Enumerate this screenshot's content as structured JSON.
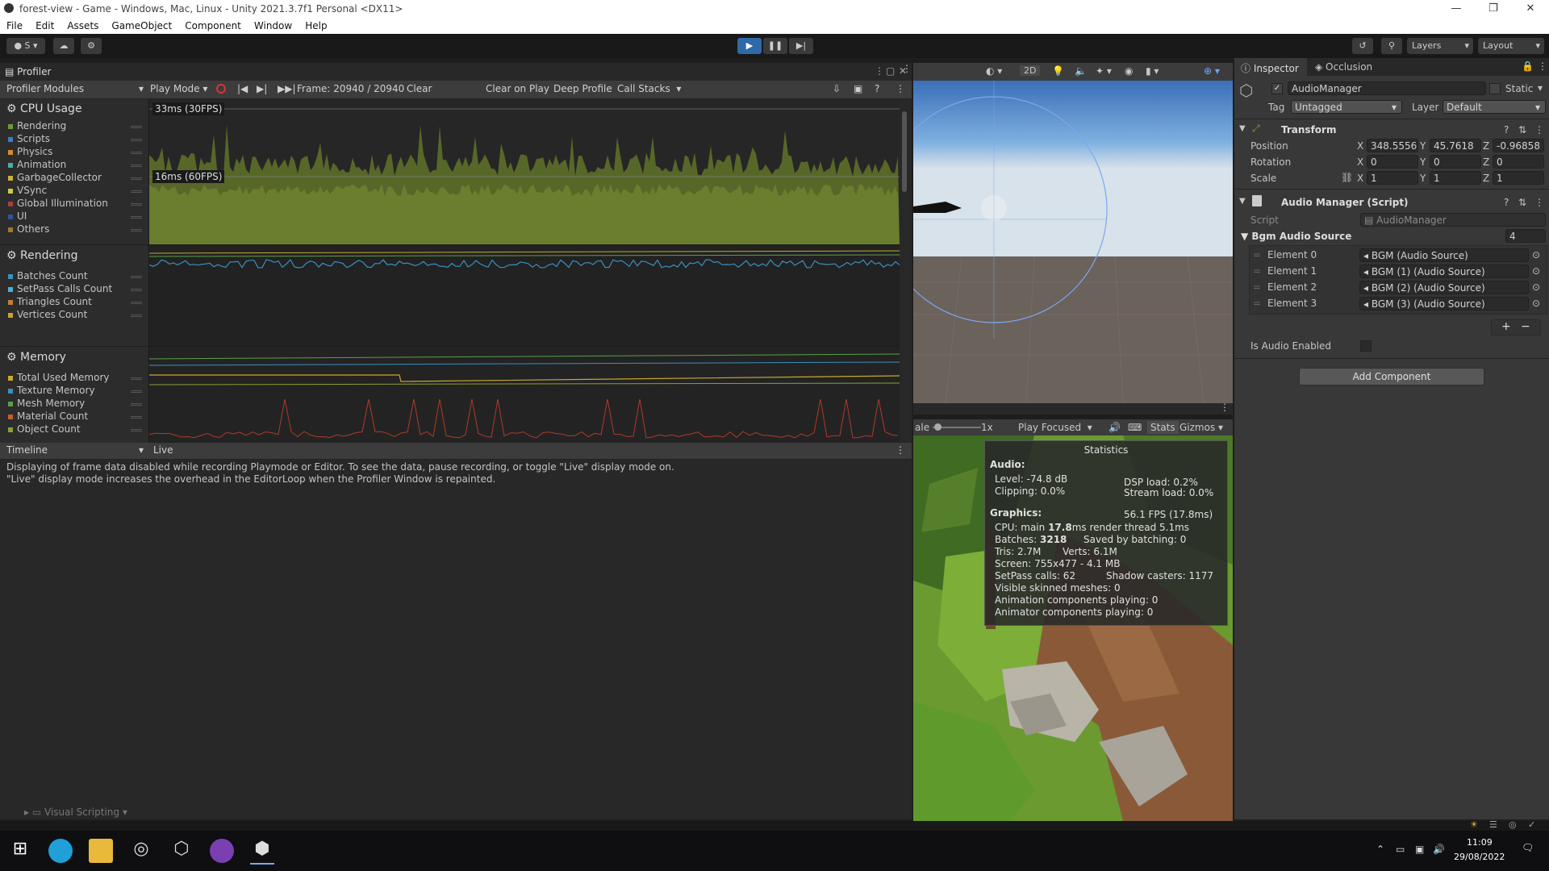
{
  "window": {
    "title": "forest-view - Game - Windows, Mac, Linux - Unity 2021.3.7f1 Personal <DX11>",
    "controls": [
      "—",
      "❐",
      "✕"
    ]
  },
  "menu": [
    "File",
    "Edit",
    "Assets",
    "GameObject",
    "Component",
    "Window",
    "Help"
  ],
  "toolbar": {
    "account": "S",
    "layers": "Layers",
    "layout": "Layout"
  },
  "profiler": {
    "tab": "Profiler",
    "modules_label": "Profiler Modules",
    "play_mode": "Play Mode",
    "frame": "Frame: 20940 / 20940",
    "clear": "Clear",
    "clear_on_play": "Clear on Play",
    "deep_profile": "Deep Profile",
    "call_stacks": "Call Stacks",
    "cpu": {
      "title": "CPU Usage",
      "marker_33": "33ms (30FPS)",
      "marker_16": "16ms (60FPS)",
      "legend": [
        {
          "label": "Rendering",
          "color": "#6b9b3a"
        },
        {
          "label": "Scripts",
          "color": "#3a7ec5"
        },
        {
          "label": "Physics",
          "color": "#d68a2c"
        },
        {
          "label": "Animation",
          "color": "#45b0a8"
        },
        {
          "label": "GarbageCollector",
          "color": "#c8b040"
        },
        {
          "label": "VSync",
          "color": "#cccc44"
        },
        {
          "label": "Global Illumination",
          "color": "#a64040"
        },
        {
          "label": "UI",
          "color": "#3050a0"
        },
        {
          "label": "Others",
          "color": "#a07830"
        }
      ]
    },
    "rendering": {
      "title": "Rendering",
      "legend": [
        {
          "label": "Batches Count",
          "color": "#3a90c0"
        },
        {
          "label": "SetPass Calls Count",
          "color": "#4ab0d0"
        },
        {
          "label": "Triangles Count",
          "color": "#c08030"
        },
        {
          "label": "Vertices Count",
          "color": "#d0a030"
        }
      ]
    },
    "memory": {
      "title": "Memory",
      "legend": [
        {
          "label": "Total Used Memory",
          "color": "#c8a830"
        },
        {
          "label": "Texture Memory",
          "color": "#3a90c0"
        },
        {
          "label": "Mesh Memory",
          "color": "#5aa048"
        },
        {
          "label": "Material Count",
          "color": "#c06030"
        },
        {
          "label": "Object Count",
          "color": "#8aa030"
        }
      ]
    },
    "timeline": "Timeline",
    "live": "Live",
    "message_1": "Displaying of frame data disabled while recording Playmode or Editor. To see the data, pause recording, or toggle \"Live\" display mode on.",
    "message_2": "\"Live\" display mode increases the overhead in the EditorLoop when the Profiler Window is repainted.",
    "visual_scripting": "Visual Scripting"
  },
  "scene_toolbar": {
    "twod": "2D"
  },
  "game_toolbar": {
    "scale_label": "ale",
    "scale_value": "1x",
    "play_focused": "Play Focused",
    "stats": "Stats",
    "gizmos": "Gizmos"
  },
  "stats": {
    "title": "Statistics",
    "audio": "Audio:",
    "level": "Level: -74.8 dB",
    "clipping": "Clipping: 0.0%",
    "dsp": "DSP load: 0.2%",
    "stream": "Stream load: 0.0%",
    "graphics": "Graphics:",
    "fps": "56.1 FPS (17.8ms)",
    "cpu_main_label": "CPU: main",
    "cpu_main_value": "17.8",
    "cpu_render": "ms  render thread 5.1ms",
    "batches_label": "Batches:",
    "batches_value": "3218",
    "saved": "Saved by batching: 0",
    "tris": "Tris: 2.7M",
    "verts": "Verts: 6.1M",
    "screen": "Screen: 755x477 - 4.1 MB",
    "setpass": "SetPass calls: 62",
    "shadow": "Shadow casters: 1177",
    "skinned": "Visible skinned meshes: 0",
    "anim": "Animation components playing: 0",
    "animator": "Animator components playing: 0"
  },
  "inspector": {
    "tab": "Inspector",
    "tab2": "Occlusion",
    "object_name": "AudioManager",
    "static": "Static",
    "tag_label": "Tag",
    "tag_value": "Untagged",
    "layer_label": "Layer",
    "layer_value": "Default",
    "transform": {
      "title": "Transform",
      "position_label": "Position",
      "rotation_label": "Rotation",
      "scale_label": "Scale",
      "position": [
        "348.5556",
        "45.7618",
        "-0.96858"
      ],
      "rotation": [
        "0",
        "0",
        "0"
      ],
      "scale": [
        "1",
        "1",
        "1"
      ],
      "x": "X",
      "y": "Y",
      "z": "Z"
    },
    "audio_manager": {
      "title": "Audio Manager (Script)",
      "script_label": "Script",
      "script_value": "AudioManager",
      "bgm_label": "Bgm Audio Source",
      "bgm_count": "4",
      "elements": [
        {
          "label": "Element 0",
          "value": "BGM (Audio Source)"
        },
        {
          "label": "Element 1",
          "value": "BGM (1) (Audio Source)"
        },
        {
          "label": "Element 2",
          "value": "BGM (2) (Audio Source)"
        },
        {
          "label": "Element 3",
          "value": "BGM (3) (Audio Source)"
        }
      ],
      "audio_enabled_label": "Is Audio Enabled",
      "plus": "+",
      "minus": "−"
    },
    "add_component": "Add Component"
  },
  "taskbar": {
    "time": "11:09",
    "date": "29/08/2022"
  }
}
